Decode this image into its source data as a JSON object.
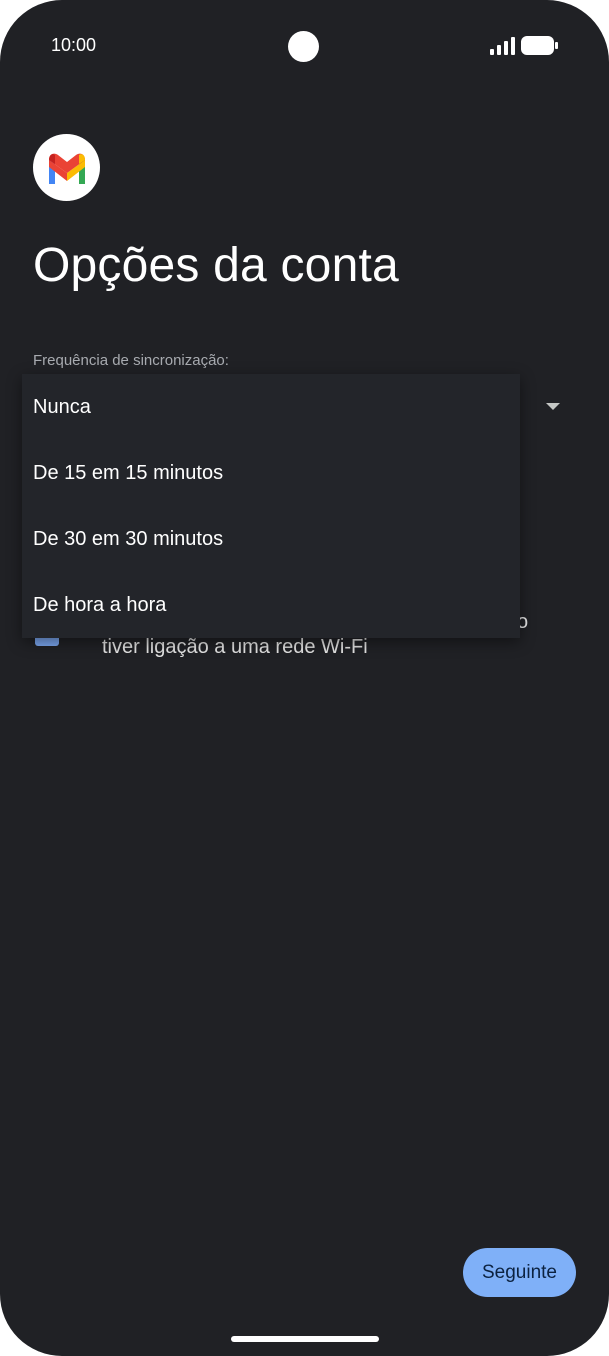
{
  "status_bar": {
    "time": "10:00",
    "icons": [
      "signal-icon",
      "battery-icon"
    ]
  },
  "header": {
    "logo_icon": "gmail-logo-icon",
    "title": "Opções da conta"
  },
  "sync": {
    "label": "Frequência de sincronização:",
    "selected": "Nunca",
    "options": [
      "Nunca",
      "De 15 em 15 minutos",
      "De 30 em 30 minutos",
      "De hora a hora"
    ]
  },
  "background_checkbox": {
    "checked": true,
    "text_fragment": "o",
    "text_line": "tiver ligação a uma rede Wi-Fi"
  },
  "footer": {
    "next_label": "Seguinte"
  },
  "colors": {
    "background": "#202125",
    "accent": "#7fb0f8",
    "menu": "#23252a"
  }
}
